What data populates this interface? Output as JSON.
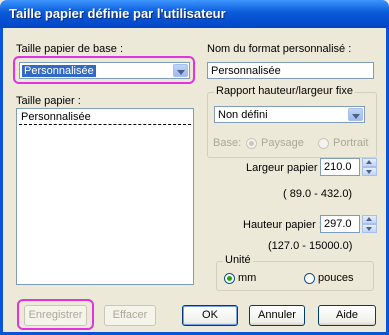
{
  "window": {
    "title": "Taille papier définie par l'utilisateur"
  },
  "left": {
    "base_label": "Taille papier de base :",
    "base_value": "Personnalisée",
    "paper_label": "Taille papier :",
    "paper_items": [
      "Personnalisée"
    ]
  },
  "right": {
    "format_name_label": "Nom du format personnalisé :",
    "format_name_value": "Personnalisée",
    "ratio_group_label": "Rapport hauteur/largeur fixe",
    "ratio_value": "Non défini",
    "base_label": "Base:",
    "base_opt_landscape": "Paysage",
    "base_opt_portrait": "Portrait",
    "width_label": "Largeur papier :",
    "width_value": "210.0",
    "width_range": "( 89.0 - 432.0)",
    "height_label": "Hauteur papier :",
    "height_value": "297.0",
    "height_range": "(127.0 - 15000.0)",
    "unit_label": "Unité",
    "unit_mm": "mm",
    "unit_inches": "pouces",
    "unit_selected": "mm"
  },
  "buttons": {
    "save": "Enregistrer",
    "delete": "Effacer",
    "ok": "OK",
    "cancel": "Annuler",
    "help": "Aide"
  },
  "colors": {
    "highlight": "#e233e2",
    "title_bar": "#0a5ad8"
  }
}
